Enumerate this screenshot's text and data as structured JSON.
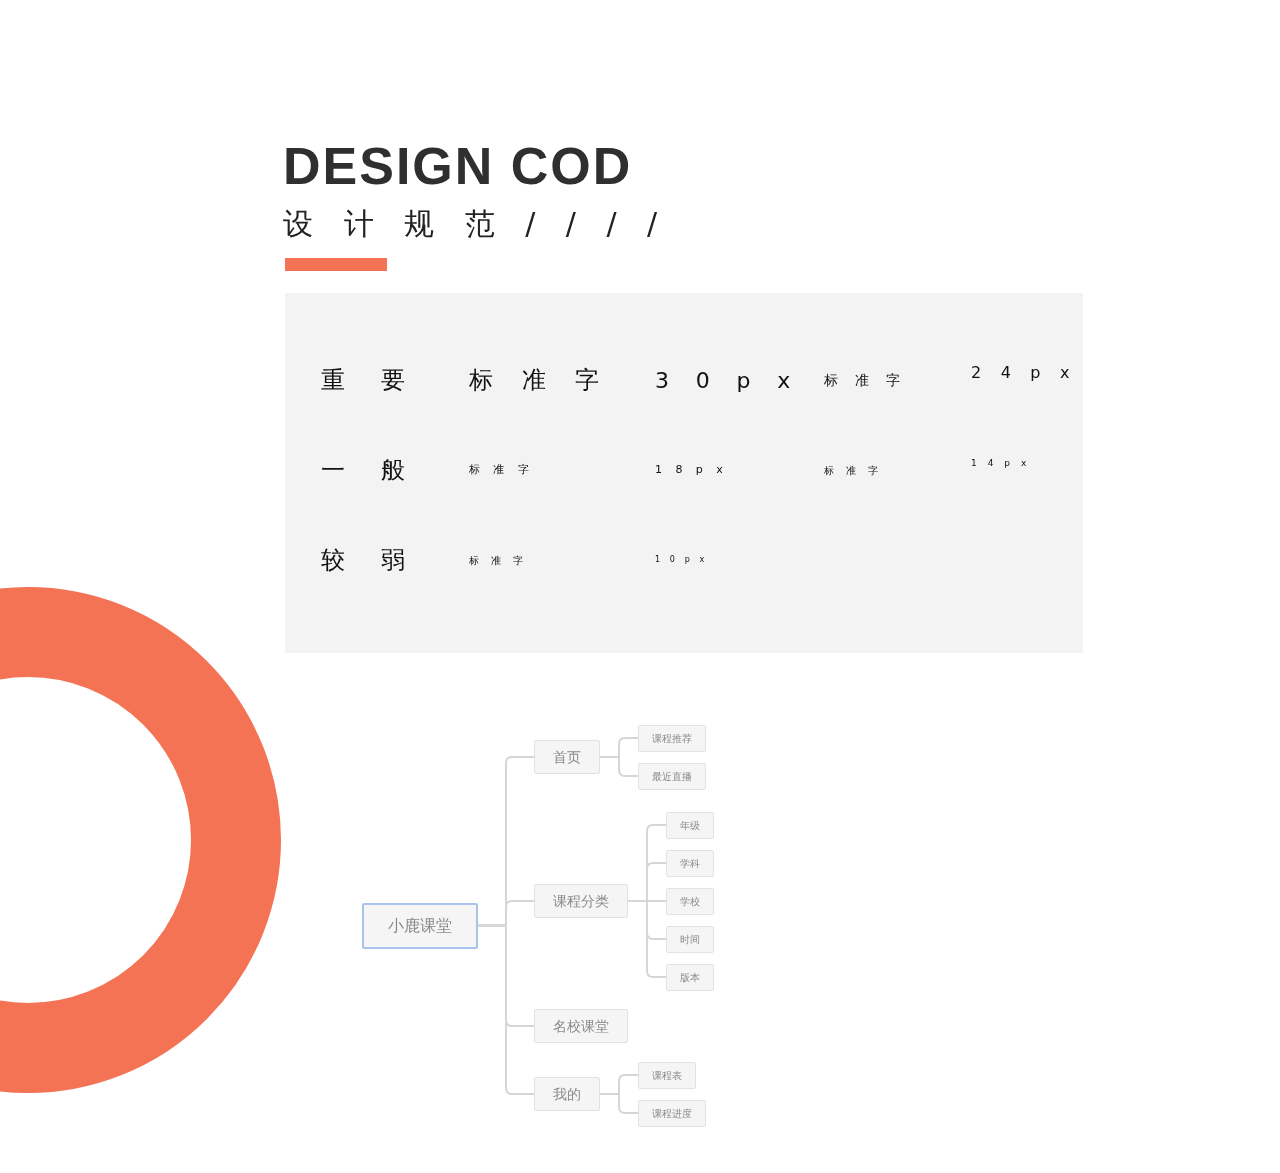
{
  "heading": {
    "title": "DESIGN COD",
    "subtitle": "设 计 规 范 / / / /"
  },
  "typography": [
    {
      "label": "重 要",
      "samples": [
        {
          "text": "标 准 字",
          "size": "3 0 p x"
        },
        {
          "text": "标 准 字",
          "size": "2 4 p x"
        }
      ]
    },
    {
      "label": "一 般",
      "samples": [
        {
          "text": "标 准 字",
          "size": "1 8 p x"
        },
        {
          "text": "标 准 字",
          "size": "1 4 p x"
        }
      ]
    },
    {
      "label": "较 弱",
      "samples": [
        {
          "text": "标 准 字",
          "size": "1 0 p x"
        }
      ]
    }
  ],
  "mind_map": {
    "label": "小鹿课堂",
    "selected": true,
    "children": [
      {
        "label": "首页",
        "selected": false,
        "children": [
          {
            "label": "课程推荐",
            "selected": false
          },
          {
            "label": "最近直播",
            "selected": false
          }
        ]
      },
      {
        "label": "课程分类",
        "selected": false,
        "children": [
          {
            "label": "年级",
            "selected": false
          },
          {
            "label": "学科",
            "selected": false
          },
          {
            "label": "学校",
            "selected": false
          },
          {
            "label": "时间",
            "selected": false
          },
          {
            "label": "版本",
            "selected": false
          }
        ]
      },
      {
        "label": "名校课堂",
        "selected": false
      },
      {
        "label": "我的",
        "selected": false,
        "children": [
          {
            "label": "课程表",
            "selected": false
          },
          {
            "label": "课程进度",
            "selected": false
          }
        ]
      }
    ]
  }
}
